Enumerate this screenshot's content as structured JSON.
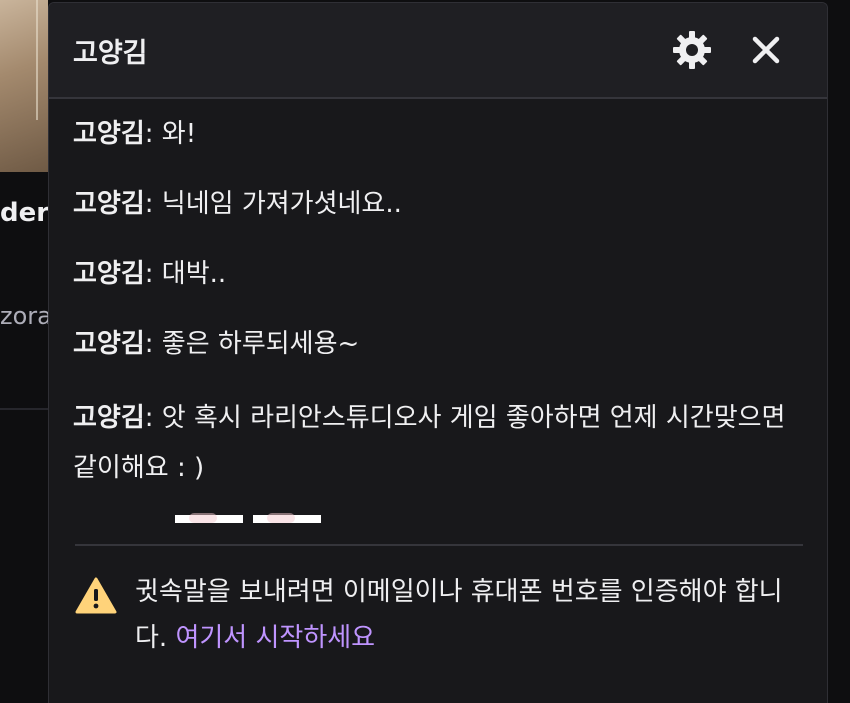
{
  "background": {
    "partial_title": "der",
    "partial_subtitle": "zora"
  },
  "whisper": {
    "title": "고양김",
    "icons": {
      "settings": "gear-icon",
      "close": "close-icon",
      "warning": "warning-triangle-icon"
    },
    "messages": [
      {
        "author": "고양김",
        "separator": ": ",
        "text": "와!"
      },
      {
        "author": "고양김",
        "separator": ": ",
        "text": "닉네임 가져가셧네요.."
      },
      {
        "author": "고양김",
        "separator": ": ",
        "text": "대박.."
      },
      {
        "author": "고양김",
        "separator": ": ",
        "text": "좋은 하루되세용~"
      },
      {
        "author": "고양김",
        "separator": ": ",
        "text": "앗 혹시 라리안스튜디오사 게임 좋아하면 언제 시간맞으면 같이해요 : )"
      }
    ],
    "notice": {
      "text": "귓속말을 보내려면 이메일이나 휴대폰 번호를 인증해야 합니다. ",
      "link": "여기서 시작하세요"
    },
    "colors": {
      "panel_bg": "#18181b",
      "header_bg": "#1f1f23",
      "text": "#efeff1",
      "link": "#bf94ff",
      "warning": "#ffd37a"
    }
  }
}
